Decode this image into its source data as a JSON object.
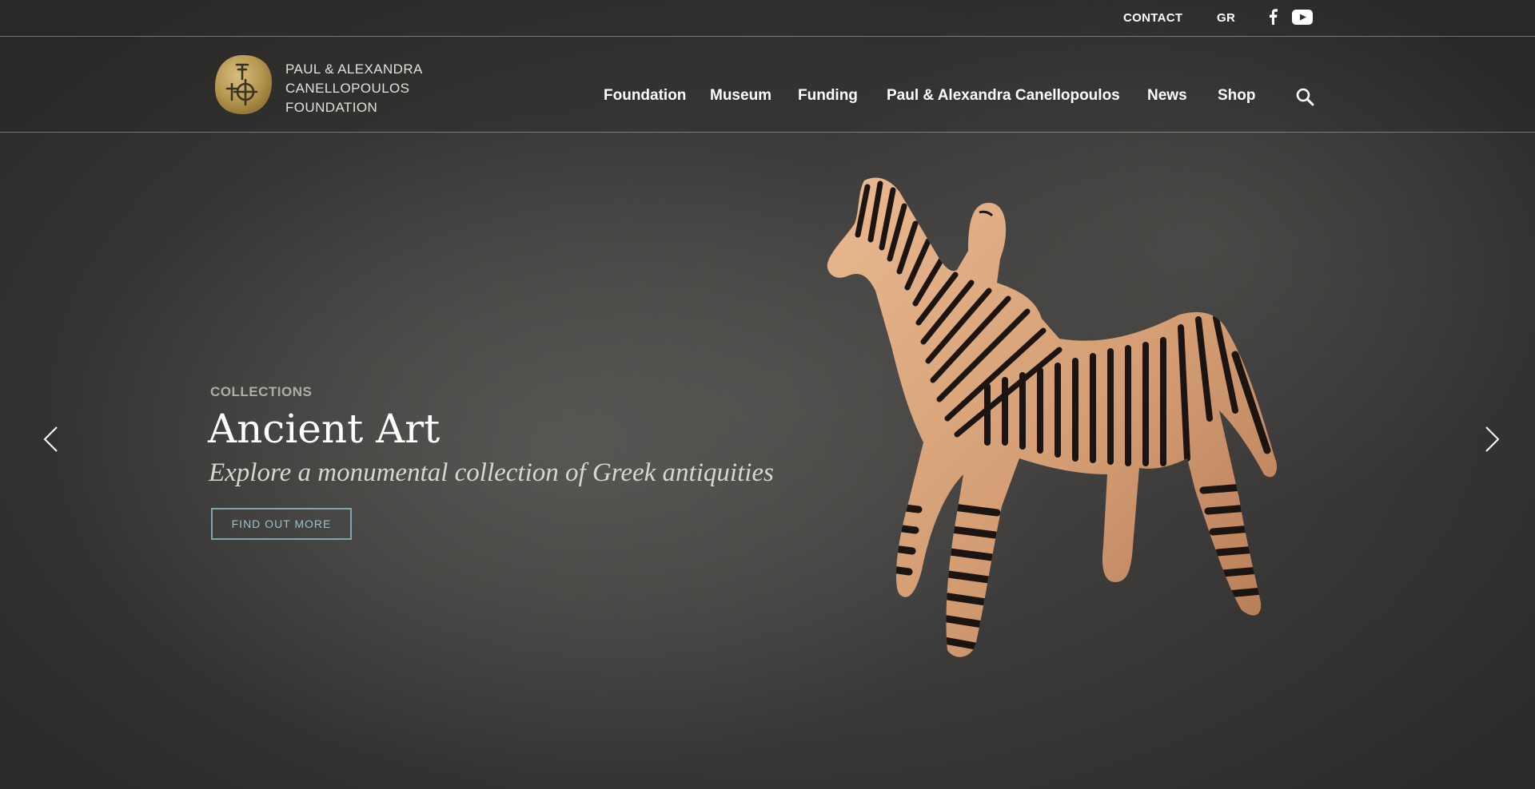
{
  "topbar": {
    "contact_label": "CONTACT",
    "language_label": "GR",
    "social": [
      "facebook-icon",
      "youtube-icon"
    ]
  },
  "header": {
    "logo_lines": [
      "PAUL & ALEXANDRA",
      "CANELLOPOULOS",
      "FOUNDATION"
    ],
    "nav": [
      {
        "label": "Foundation"
      },
      {
        "label": "Museum"
      },
      {
        "label": "Funding"
      },
      {
        "label": "Paul & Alexandra Canellopoulos"
      },
      {
        "label": "News"
      },
      {
        "label": "Shop"
      }
    ],
    "search_icon": "search-icon"
  },
  "hero": {
    "kicker": "COLLECTIONS",
    "title": "Ancient Art",
    "subtitle": "Explore a monumental collection of Greek antiquities",
    "button_label": "FIND OUT MORE",
    "prev_icon": "chevron-left-icon",
    "next_icon": "chevron-right-icon"
  },
  "colors": {
    "background": "#3b3a39",
    "accent": "#7fa6ad",
    "logo_gold": "#b89a56",
    "terracotta": "#d9a57c"
  }
}
